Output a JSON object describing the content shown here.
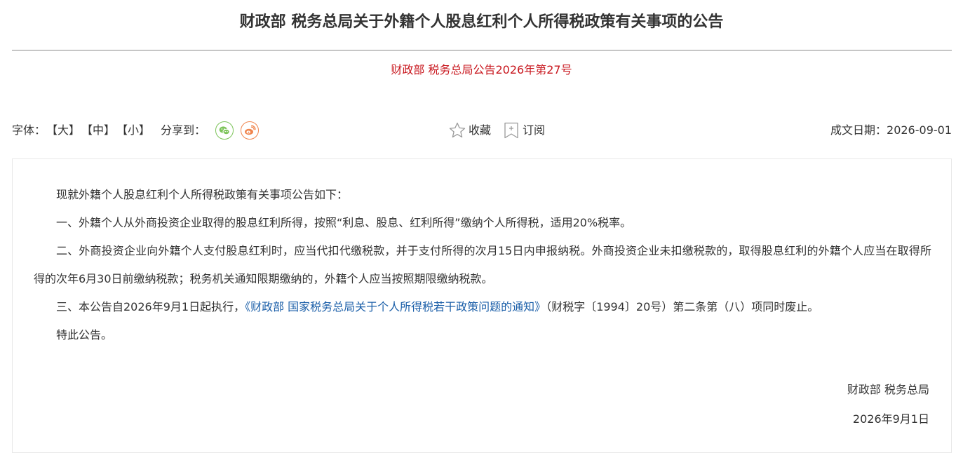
{
  "header": {
    "title": "财政部 税务总局关于外籍个人股息红利个人所得税政策有关事项的公告",
    "doc_number": "财政部 税务总局公告2026年第27号"
  },
  "toolbar": {
    "font_label": "字体：",
    "size_large": "【大】",
    "size_medium": "【中】",
    "size_small": "【小】",
    "share_label": "分享到：",
    "favorite_label": "收藏",
    "subscribe_label": "订阅",
    "date_label": "成文日期：",
    "date_value": "2026-09-01"
  },
  "body": {
    "intro": "现就外籍个人股息红利个人所得税政策有关事项公告如下：",
    "item1": "一、外籍个人从外商投资企业取得的股息红利所得，按照“利息、股息、红利所得”缴纳个人所得税，适用20%税率。",
    "item2": "二、外商投资企业向外籍个人支付股息红利时，应当代扣代缴税款，并于支付所得的次月15日内申报纳税。外商投资企业未扣缴税款的，取得股息红利的外籍个人应当在取得所得的次年6月30日前缴纳税款；税务机关通知限期缴纳的，外籍个人应当按照期限缴纳税款。",
    "item3_before": "三、本公告自2026年9月1日起执行，",
    "item3_link": "《财政部 国家税务总局关于个人所得税若干政策问题的通知》",
    "item3_after": "（财税字〔1994〕20号）第二条第（八）项同时废止。",
    "closing": "特此公告。"
  },
  "signature": {
    "issuer": "财政部 税务总局",
    "date": "2026年9月1日"
  },
  "colors": {
    "doc_number": "#c8161d",
    "link": "#1a5ea8",
    "wechat": "#7dc45a",
    "weibo": "#f0854e"
  },
  "icons": {
    "wechat": "wechat-icon",
    "weibo": "weibo-icon",
    "favorite": "star-icon",
    "subscribe": "bookmark-plus-icon"
  }
}
